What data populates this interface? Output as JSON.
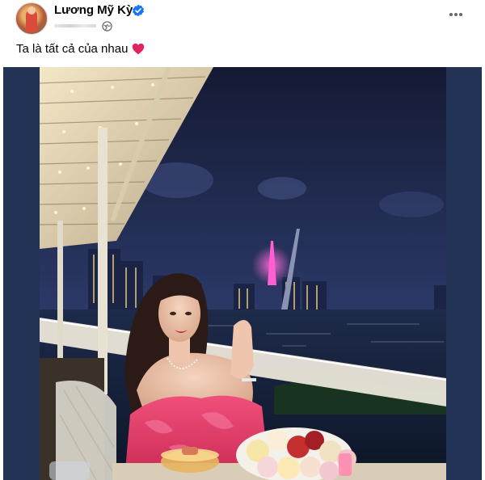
{
  "post": {
    "author": "Lương Mỹ Kỳ",
    "caption": "Ta là tất cả của nhau",
    "privacy_icon": "globe-icon",
    "verified_icon": "verified-badge-icon",
    "more_icon": "more-options-icon",
    "caption_emoji": "heart-icon"
  },
  "colors": {
    "text": "#050505",
    "verified": "#1877f2",
    "heart": "#e0245e",
    "photo_background": "#233356"
  }
}
